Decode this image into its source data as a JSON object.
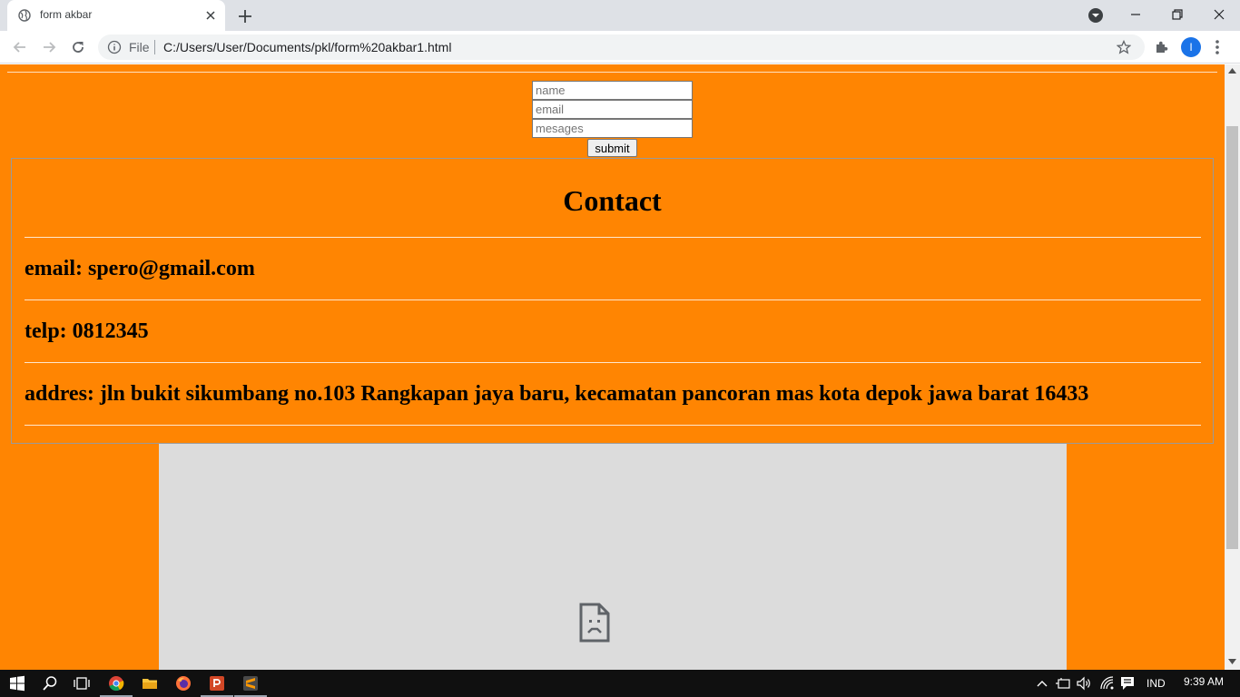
{
  "browser": {
    "tab_title": "form akbar",
    "address_prefix": "File",
    "url": "C:/Users/User/Documents/pkl/form%20akbar1.html",
    "profile_initial": "I"
  },
  "form": {
    "name_placeholder": "name",
    "email_placeholder": "email",
    "message_placeholder": "mesages",
    "submit_label": "submit"
  },
  "contact": {
    "title": "Contact",
    "email": "email: spero@gmail.com",
    "phone": "telp: 0812345",
    "address": "addres: jln bukit sikumbang no.103 Rangkapan jaya baru, kecamatan pancoran mas kota depok jawa barat 16433"
  },
  "taskbar": {
    "language": "IND",
    "time": "9:39 AM"
  },
  "colors": {
    "page_background": "#ff8502",
    "iframe_background": "#dcdcdc"
  }
}
